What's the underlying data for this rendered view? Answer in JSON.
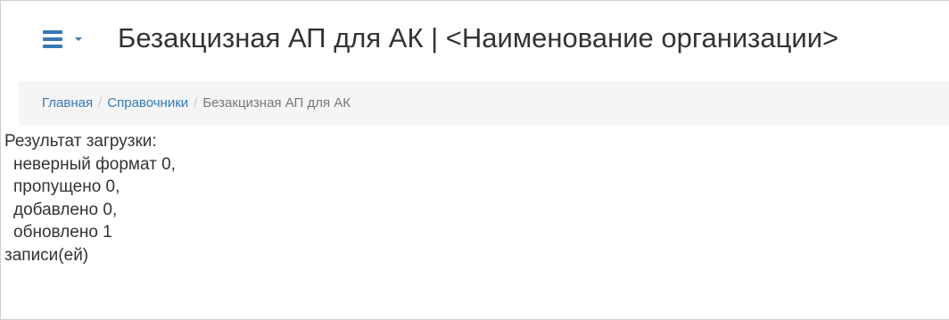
{
  "header": {
    "title": "Безакцизная АП для АК | <Наименование организации>",
    "menu_icon": "hamburger-icon",
    "accent_color": "#337ab7"
  },
  "breadcrumb": {
    "items": [
      {
        "label": "Главная",
        "link": true
      },
      {
        "label": "Справочники",
        "link": true
      },
      {
        "label": "Безакцизная АП для АК",
        "link": false
      }
    ],
    "separator": "/"
  },
  "result": {
    "heading": "Результат загрузки:",
    "lines": [
      "неверный формат 0,",
      "пропущено 0,",
      "добавлено 0,",
      "обновлено 1"
    ],
    "footer": "записи(ей)"
  }
}
